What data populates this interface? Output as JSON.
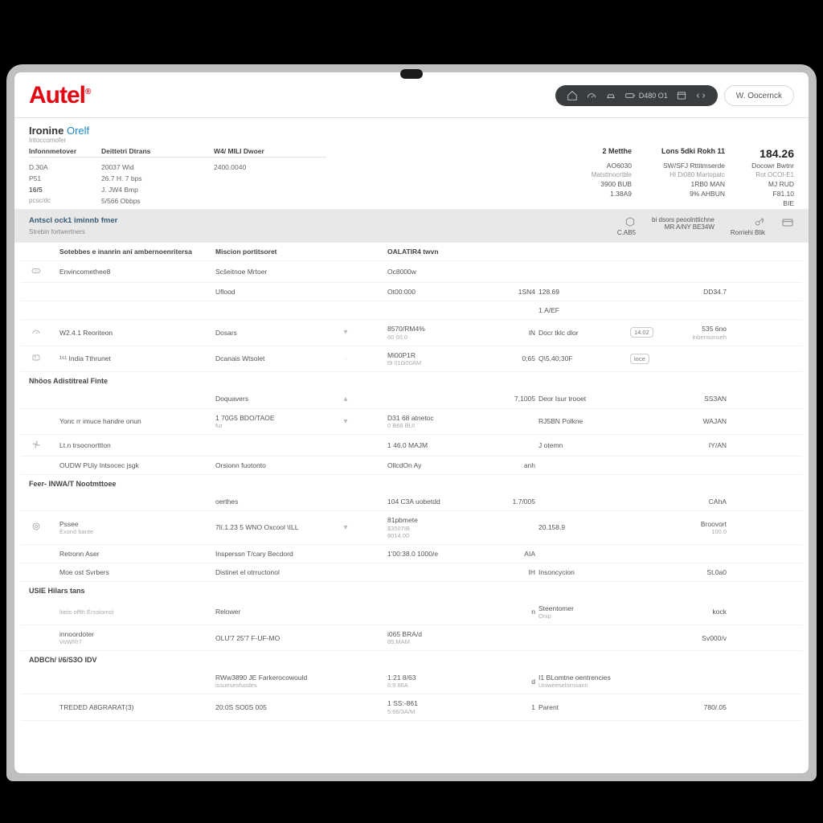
{
  "brand": {
    "name": "Autel",
    "reg": "®"
  },
  "topbar": {
    "segments": [
      {
        "icon": "home",
        "label": ""
      },
      {
        "icon": "gauge",
        "label": ""
      },
      {
        "icon": "car",
        "label": ""
      },
      {
        "icon": "battery",
        "label": "D480 O1"
      },
      {
        "icon": "window",
        "label": ""
      },
      {
        "icon": "code",
        "label": ""
      }
    ],
    "user_label": "W. Oocernck"
  },
  "info": {
    "title_a": "Ironine",
    "title_b": "Orelf",
    "subtitle": "Iritoccomofer",
    "left_headers": [
      "Infonnmetover",
      "Deittetri Dtrans",
      "W4/ MILI Dwoer"
    ],
    "left_row1": [
      "D.30A",
      "20037 Wid",
      "2400.0040"
    ],
    "left_row2": [
      "P51",
      "26.7 H. 7 bps",
      ""
    ],
    "left_row3": [
      "16/5",
      "J. JW4 Bmp",
      ""
    ],
    "left_row4": [
      "pcsc/dc",
      "5/566 Obbps",
      ""
    ],
    "right_headers": [
      "2 Metthe",
      "Lons 5dki Rokh 11",
      ""
    ],
    "right_big": "184.26",
    "right_row1": [
      "AO6030",
      "SW/SFJ Rttitmserde",
      "Docowr Bwtnr"
    ],
    "right_row2": [
      "Matsttnocrtble",
      "HI Di080 Martopatc",
      "Rot OCOI-E1"
    ],
    "right_row3": [
      "3900 BUB",
      "1RB0 MAN",
      "MJ RUD"
    ],
    "right_row4": [
      "1.38A9",
      "9% AHBUN",
      "F81.10"
    ],
    "right_row5": [
      "",
      "",
      "BIE"
    ]
  },
  "band": {
    "left_title": "Antscl ock1 iminnb fmer",
    "left_sub": "Strebin fortwertners",
    "cols": [
      {
        "icon": "hex",
        "top": "",
        "bottom": "C.AB5"
      },
      {
        "icon": "",
        "top": "bi dsors peoolnttichne",
        "bottom": "MR A/NY BE34W"
      },
      {
        "icon": "key",
        "top": "",
        "bottom": "Rorriehi Blik"
      }
    ],
    "last_icon": "card"
  },
  "columns": [
    "",
    "Sotebbes e inanrin aní ambernoenritersa",
    "Miscion portitsoret",
    "",
    "",
    "OALATIR4 twvn",
    "",
    "",
    "",
    ""
  ],
  "rows": [
    {
      "ico": "meter",
      "c2": "Envincomethee8",
      "c3": "Scšeitnoe Mrtoer",
      "c5": "",
      "c6": "Oc8000w",
      "c7": "",
      "c8": "",
      "c9": "",
      "c10": ""
    },
    {
      "ico": "",
      "c2": "",
      "c3": "Uflood",
      "c5": "",
      "c6": "Ot00:000",
      "c7": "1SN4",
      "c8": "128.69",
      "c9": "",
      "c10": "DD34.7"
    },
    {
      "ico": "",
      "c2": "",
      "c3": "",
      "c5": "",
      "c6": "",
      "c7": "",
      "c8": "1.A/EF",
      "c9": "",
      "c10": ""
    },
    {
      "ico": "gauge",
      "c2": "W2.4.1  Reoriteon",
      "c3": "Dosars",
      "chev": "▾",
      "c5": "",
      "c6": "8570/RM4%\n60 00.0",
      "c7": "lN",
      "c8": "Docr tklc dlor",
      "c9": "14.02",
      "c10": "535 6no\ninbensonseh"
    },
    {
      "ico": "temp",
      "c2": "¹⁵¹  India Tthrunet",
      "c3": "Dcanais Wtsolet",
      "chev": "·",
      "c5": "",
      "c6": "Mi00P1R\nt9 010i00AM",
      "c7": "0;65",
      "c8": "Q\\5,40;30F",
      "c9": "loce",
      "c10": ""
    },
    {
      "sec": "Nhöos Adistitreal Finte",
      "ico": "",
      "c2": "",
      "c3": "Doquavers",
      "chev": "▴",
      "c5": "",
      "c6": "",
      "c7": "7,1005",
      "c8": "Deor Isur trooet",
      "c9": "",
      "c10": "SS3AN"
    },
    {
      "ico": "",
      "c2": "Yonc rr imuce handre onun",
      "c3": "1 70G5 BDO/TAOE\nfur",
      "chev": "▾",
      "c5": "",
      "c6": "D31 68 atnetoc\n0 B66 BUI",
      "c7": "",
      "c8": "RJ5BN Polkne",
      "c9": "",
      "c10": "WAJAN"
    },
    {
      "ico": "fan",
      "c2": "Lt.n trsocnorttton",
      "c3": "",
      "c5": "",
      "c6": "1 46.0 MAJM",
      "c7": "",
      "c8": "J otemn",
      "c9": "",
      "c10": "IY/AN"
    },
    {
      "ico": "",
      "c2": "OUDW PUiy Intsocec jsgk",
      "c3": "Orsionn fuotonto",
      "c5": "",
      "c6": "OllcdOn Ay",
      "c7": "anh",
      "c8": "",
      "c9": "",
      "c10": ""
    },
    {
      "sec": "Feer- INWA/T Nootmttoee",
      "ico": "",
      "c2": "",
      "c3": "oerthes",
      "c5": "",
      "c6": "104 C3A uobetdd",
      "c7": "1.7/005",
      "c8": "",
      "c9": "",
      "c10": "CAhA"
    },
    {
      "ico": "target",
      "c2": "Pssee\nExonó bante",
      "c3": "7lí.1.23 5 WNO Oxcool \\ILL",
      "chev": "▾",
      "c5": "",
      "c6": "81pbmete\n$3507IB\n8014.00",
      "c7": "",
      "c8": "20.158.9",
      "c9": "",
      "c10": "Broovort\n100.0"
    },
    {
      "ico": "",
      "c2": "Retronn Aser",
      "c3": "Insperssn T/cary Becdord",
      "c5": "",
      "c6": "1'00:38.0 1000/e",
      "c7": "AIA",
      "c8": "",
      "c9": "",
      "c10": ""
    },
    {
      "ico": "",
      "c2": "Moe ost Svrbers",
      "c3": "Distinet el otrructonol",
      "c5": "",
      "c6": "",
      "c7": "IH",
      "c8": "Insoncycion",
      "c9": "",
      "c10": "St.0a0"
    },
    {
      "sec": "USIE Hilars tans",
      "ico": "",
      "c2": "\nlitets offth Érsstomst",
      "c3": "Relower",
      "c5": "",
      "c6": "",
      "c7": "n",
      "c8": "Steentomer\nOnip",
      "c9": "",
      "c10": "kock"
    },
    {
      "ico": "",
      "c2": "innoordoter\nVoWRr7",
      "c3": "OLU'7 25'7 F-UF-MO",
      "c5": "",
      "c6": "i065 BRA/d\n85:MAM",
      "c7": "",
      "c8": "",
      "c9": "",
      "c10": "Sv000/v"
    },
    {
      "sec": "ADBCh/  i/6/S3O IDV",
      "ico": "",
      "c2": "",
      "c3": "RWw3890 JE Farkerocowould\nissuesesfuodes",
      "c5": "",
      "c6": "1:21 8/63\n6:9 86A",
      "c7": "d",
      "c8": "I1 BLomtne oentrencies\nUniweeselornsann",
      "c9": "",
      "c10": ""
    },
    {
      "ico": "",
      "c2": "TREDED A8GRARAT(3)",
      "c3": "20:0S SO0S 005",
      "c5": "",
      "c6": "1 SS:-861\n5:66/3A/M",
      "c7": "1",
      "c8": "Parent",
      "c9": "",
      "c10": "780/.05"
    }
  ]
}
